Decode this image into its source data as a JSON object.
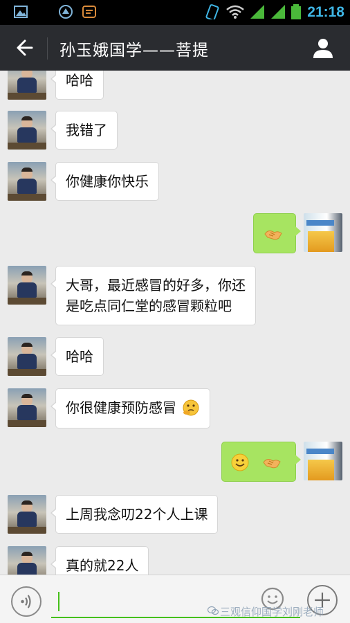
{
  "status_bar": {
    "time": "21:18",
    "icons": [
      "gallery-icon",
      "sync-icon",
      "app-icon",
      "vibrate-icon",
      "wifi-icon",
      "signal-icon",
      "signal-icon",
      "battery-icon"
    ]
  },
  "header": {
    "title": "孙玉娥国学——菩提",
    "back_icon": "back-arrow-icon",
    "profile_icon": "person-icon"
  },
  "messages": [
    {
      "side": "left",
      "text": "哈哈"
    },
    {
      "side": "left",
      "text": "我错了"
    },
    {
      "side": "left",
      "text": "你健康你快乐"
    },
    {
      "side": "right",
      "stickers": [
        "handshake-emoji"
      ]
    },
    {
      "side": "left",
      "text_line1": "大哥，最近感冒的好多，你还",
      "text_line2": "是吃点同仁堂的感冒颗粒吧"
    },
    {
      "side": "left",
      "text": "哈哈"
    },
    {
      "side": "left",
      "text": "你很健康预防感冒",
      "trailing_emoji": "thinking-face-emoji"
    },
    {
      "side": "right",
      "stickers": [
        "smile-emoji",
        "handshake-emoji"
      ]
    },
    {
      "side": "left",
      "text": "上周我念叨22个人上课"
    },
    {
      "side": "left",
      "text": "真的就22人"
    }
  ],
  "input_bar": {
    "voice_icon": "voice-icon",
    "input_value": "",
    "emoji_icon": "emoji-icon",
    "plus_icon": "plus-icon",
    "watermark": "三观信仰国学刘刚老师"
  },
  "colors": {
    "header_bg": "#2a2c30",
    "chat_bg": "#ebebeb",
    "sent_bubble": "#a7e461",
    "received_bubble": "#ffffff",
    "accent_green": "#45c01a",
    "clock_blue": "#3fb6e6"
  }
}
